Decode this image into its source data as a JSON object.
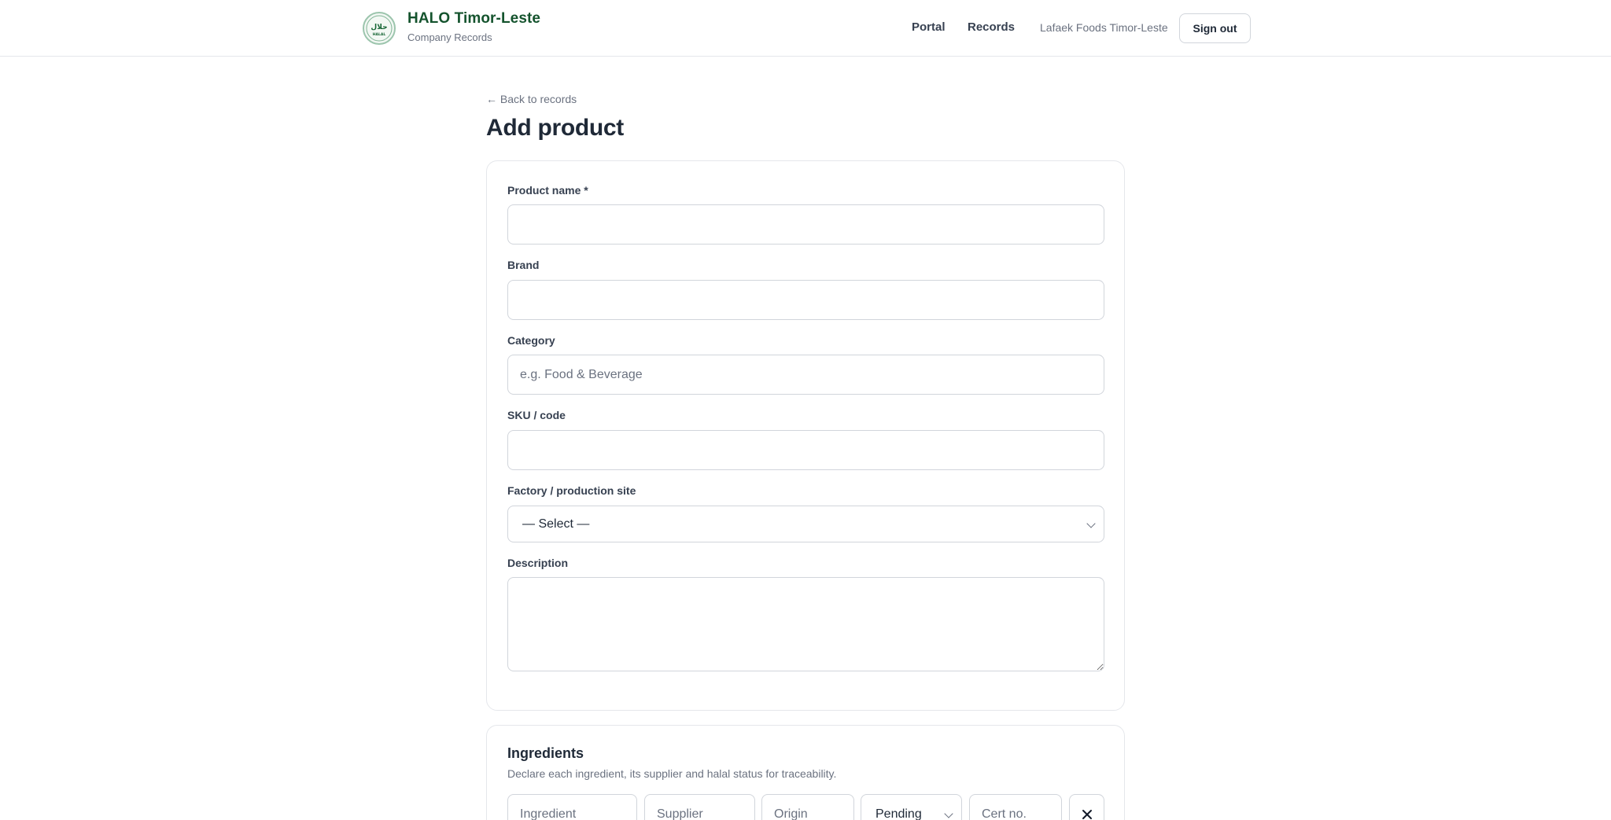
{
  "header": {
    "logo_icon": "halal-seal-icon",
    "logo_text": "حلال",
    "logo_caption": "HALAL",
    "title": "HALO Timor-Leste",
    "subtitle": "Company Records",
    "nav": {
      "portal": "Portal",
      "records": "Records"
    },
    "company": "Lafaek Foods Timor-Leste",
    "sign_out": "Sign out"
  },
  "main": {
    "back_link": "← Back to records",
    "title": "Add product"
  },
  "form": {
    "product_name": {
      "label": "Product name *",
      "value": "",
      "placeholder": ""
    },
    "brand": {
      "label": "Brand",
      "value": "",
      "placeholder": ""
    },
    "category": {
      "label": "Category",
      "value": "",
      "placeholder": "e.g. Food & Beverage"
    },
    "sku": {
      "label": "SKU / code",
      "value": "",
      "placeholder": ""
    },
    "factory": {
      "label": "Factory / production site",
      "selected": "— Select —"
    },
    "description": {
      "label": "Description",
      "value": ""
    }
  },
  "ingredients": {
    "title": "Ingredients",
    "subtitle": "Declare each ingredient, its supplier and halal status for traceability.",
    "row": {
      "ingredient_placeholder": "Ingredient",
      "supplier_placeholder": "Supplier",
      "origin_placeholder": "Origin",
      "status_selected": "Pending",
      "cert_placeholder": "Cert no.",
      "remove_icon": "close-icon"
    }
  },
  "colors": {
    "brand_green": "#14532d",
    "border": "#d1d5db",
    "muted_text": "#6b7280"
  }
}
